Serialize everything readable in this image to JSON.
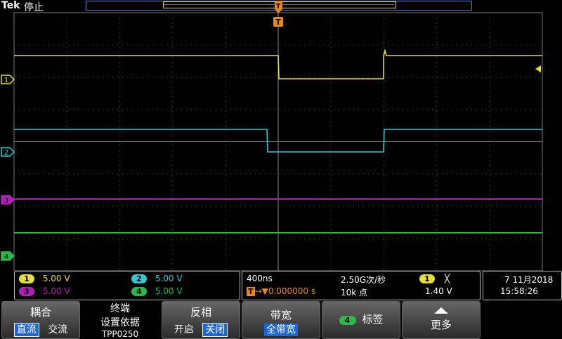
{
  "header": {
    "brand": "Tek",
    "status": "停止"
  },
  "trigger_marker": "T",
  "channels": [
    {
      "id": "1",
      "color": "#e6dc3a",
      "scale": "5.00 V"
    },
    {
      "id": "2",
      "color": "#33c8d6",
      "scale": "5.00 V"
    },
    {
      "id": "3",
      "color": "#b020b8",
      "scale": "5.00 V"
    },
    {
      "id": "4",
      "color": "#2ab84a",
      "scale": "5.00 V"
    }
  ],
  "timebase": {
    "time_div": "400ns",
    "sample_rate": "2.50G次/秒",
    "trigger_pos_icon": "T→▼",
    "trigger_pos": "0.000000 s",
    "record_length": "10k 点",
    "trigger_source": "1",
    "trigger_slope_icon": "╳",
    "trigger_level": "1.40 V"
  },
  "datetime": {
    "date": "7 11月2018",
    "time": "15:58:26"
  },
  "softkeys": {
    "coupling": {
      "label": "耦合",
      "opt1": "直流",
      "opt2": "交流"
    },
    "termination": {
      "line1": "终端",
      "line2": "设置依据",
      "line3": "TPP0250"
    },
    "invert": {
      "label": "反相",
      "opt1": "开启",
      "opt2": "关闭"
    },
    "bandwidth": {
      "label": "带宽",
      "value": "全带宽"
    },
    "label": {
      "badge": "4",
      "text": "标签"
    },
    "more": {
      "text": "更多"
    }
  },
  "colors": {
    "grid": "#6a6a6a",
    "border": "#888",
    "accent_blue": "#1e66d8",
    "trigger_orange": "#e88a1a"
  }
}
